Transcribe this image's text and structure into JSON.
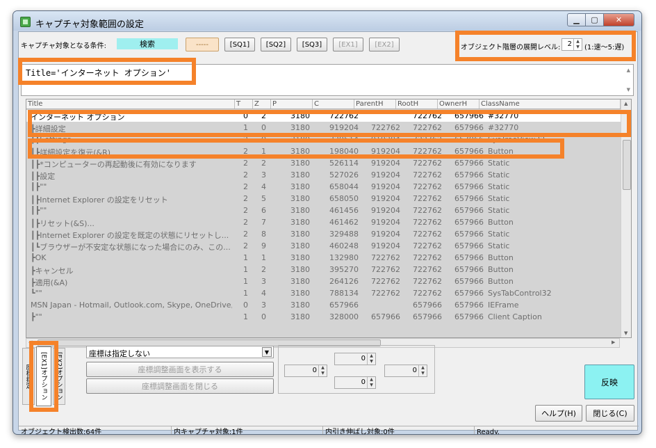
{
  "window": {
    "title": "キャプチャ対象範囲の設定",
    "min_glyph": "▁",
    "max_glyph": "▢",
    "close_glyph": "✕"
  },
  "toolbar": {
    "condition_label": "キャプチャ対象となる条件:",
    "condition_value": "検索",
    "dashes_label": "-----",
    "sq1": "[SQ1]",
    "sq2": "[SQ2]",
    "sq3": "[SQ3]",
    "ex1": "[EX1]",
    "ex2": "[EX2]",
    "level_label": "オブジェクト階層の展開レベル:",
    "level_value": "2",
    "level_hint": "(1:速〜5:遅)"
  },
  "query": {
    "text": "Title='インターネット オプション'"
  },
  "grid": {
    "columns": [
      "Title",
      "T",
      "Z",
      "P",
      "C",
      "ParentH",
      "RootH",
      "OwnerH",
      "ClassName"
    ],
    "rows": [
      {
        "title": "インターネット オプション",
        "t": "0",
        "z": "2",
        "p": "3180",
        "c": "722762",
        "parent": "",
        "root": "722762",
        "owner": "657966",
        "cls": "#32770"
      },
      {
        "title": "┣詳細設定",
        "t": "1",
        "z": "0",
        "p": "3180",
        "c": "919204",
        "parent": "722762",
        "root": "722762",
        "owner": "657966",
        "cls": "#32770"
      },
      {
        "title": "┃┣Settings",
        "t": "2",
        "z": "0",
        "p": "3180",
        "c": "329514",
        "parent": "919204",
        "root": "722762",
        "owner": "657966",
        "cls": "SysTreeView32"
      },
      {
        "title": "┃┣詳細設定を復元(&R)",
        "t": "2",
        "z": "1",
        "p": "3180",
        "c": "198040",
        "parent": "919204",
        "root": "722762",
        "owner": "657966",
        "cls": "Button"
      },
      {
        "title": "┃┣*コンピューターの再起動後に有効になります",
        "t": "2",
        "z": "2",
        "p": "3180",
        "c": "526114",
        "parent": "919204",
        "root": "722762",
        "owner": "657966",
        "cls": "Static"
      },
      {
        "title": "┃┣設定",
        "t": "2",
        "z": "3",
        "p": "3180",
        "c": "527026",
        "parent": "919204",
        "root": "722762",
        "owner": "657966",
        "cls": "Static"
      },
      {
        "title": "┃┣\"\"",
        "t": "2",
        "z": "4",
        "p": "3180",
        "c": "658044",
        "parent": "919204",
        "root": "722762",
        "owner": "657966",
        "cls": "Static"
      },
      {
        "title": "┃┣Internet Explorer の設定をリセット",
        "t": "2",
        "z": "5",
        "p": "3180",
        "c": "658050",
        "parent": "919204",
        "root": "722762",
        "owner": "657966",
        "cls": "Static"
      },
      {
        "title": "┃┣\"\"",
        "t": "2",
        "z": "6",
        "p": "3180",
        "c": "461456",
        "parent": "919204",
        "root": "722762",
        "owner": "657966",
        "cls": "Static"
      },
      {
        "title": "┃┣リセット(&S)...",
        "t": "2",
        "z": "7",
        "p": "3180",
        "c": "461462",
        "parent": "919204",
        "root": "722762",
        "owner": "657966",
        "cls": "Button"
      },
      {
        "title": "┃┣Internet Explorer の設定を既定の状態にリセットし...",
        "t": "2",
        "z": "8",
        "p": "3180",
        "c": "329488",
        "parent": "919204",
        "root": "722762",
        "owner": "657966",
        "cls": "Static"
      },
      {
        "title": "┃┗ブラウザーが不安定な状態になった場合にのみ、この...",
        "t": "2",
        "z": "9",
        "p": "3180",
        "c": "460248",
        "parent": "919204",
        "root": "722762",
        "owner": "657966",
        "cls": "Static"
      },
      {
        "title": "┣OK",
        "t": "1",
        "z": "1",
        "p": "3180",
        "c": "132980",
        "parent": "722762",
        "root": "722762",
        "owner": "657966",
        "cls": "Button"
      },
      {
        "title": "┣キャンセル",
        "t": "1",
        "z": "2",
        "p": "3180",
        "c": "395270",
        "parent": "722762",
        "root": "722762",
        "owner": "657966",
        "cls": "Button"
      },
      {
        "title": "┣適用(&A)",
        "t": "1",
        "z": "3",
        "p": "3180",
        "c": "264126",
        "parent": "722762",
        "root": "722762",
        "owner": "657966",
        "cls": "Button"
      },
      {
        "title": "┗\"\"",
        "t": "1",
        "z": "4",
        "p": "3180",
        "c": "788134",
        "parent": "722762",
        "root": "722762",
        "owner": "657966",
        "cls": "SysTabControl32"
      },
      {
        "title": "MSN Japan - Hotmail, Outlook.com, Skype, OneDrive,...",
        "t": "0",
        "z": "3",
        "p": "3180",
        "c": "657966",
        "parent": "",
        "root": "657966",
        "owner": "657966",
        "cls": "IEFrame"
      },
      {
        "title": "┣\"\"",
        "t": "1",
        "z": "0",
        "p": "3180",
        "c": "328000",
        "parent": "657966",
        "root": "657966",
        "owner": "657966",
        "cls": "Client Caption"
      }
    ]
  },
  "bottom": {
    "tab_coords": "座標指定",
    "tab_ex1": "[EX1]オプション",
    "tab_ex2": "[EX2]オプション",
    "coord_select": "座標は指定しない",
    "show_adjust": "座標調整画面を表示する",
    "close_adjust": "座標調整画面を閉じる",
    "spin_top": "0",
    "spin_left": "0",
    "spin_right": "0",
    "spin_bottom": "0",
    "apply": "反映",
    "help": "ヘルプ(H)",
    "close": "閉じる(C)"
  },
  "statusbar": {
    "detected": "オブジェクト検出数:64件",
    "captured": "内キャプチャ対象:1件",
    "stretched": "内引き伸ばし対象:0件",
    "ready": "Ready."
  },
  "colors": {
    "highlight": "#f5822a",
    "accent_button": "#9fefef"
  }
}
